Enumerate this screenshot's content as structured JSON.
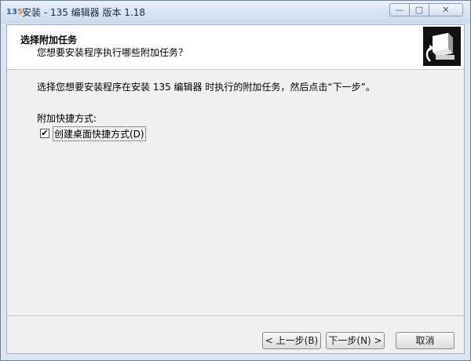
{
  "window": {
    "title": "安装 - 135 编辑器 版本 1.18",
    "controls": {
      "minimize": "—",
      "maximize": "□",
      "close": "✕"
    }
  },
  "header": {
    "title": "选择附加任务",
    "subtitle": "您想要安装程序执行哪些附加任务？"
  },
  "main": {
    "instruction": "选择您想要安装程序在安装 135 编辑器 时执行的附加任务，然后点击“下一步”。",
    "group_label": "附加快捷方式:",
    "checkbox": {
      "label": "创建桌面快捷方式(D)",
      "checked": true,
      "mark": "✔"
    }
  },
  "buttons": {
    "back": "< 上一步(B)",
    "next": "下一步(N) >",
    "cancel": "取消"
  }
}
